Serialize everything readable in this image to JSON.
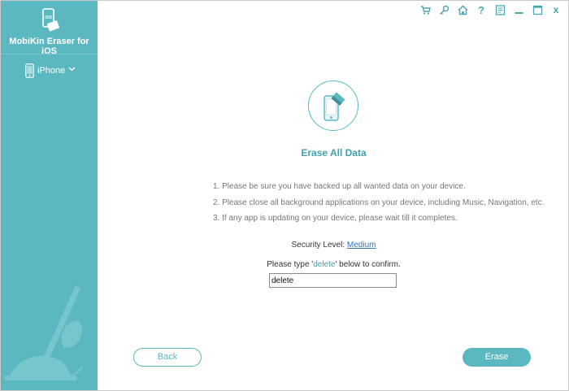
{
  "app": {
    "name": "MobiKin Eraser for iOS",
    "logo_text": "iOS"
  },
  "sidebar": {
    "device_label": "iPhone"
  },
  "titlebar": {
    "icons": [
      "cart-icon",
      "key-icon",
      "home-icon",
      "help-icon",
      "feedback-icon",
      "minimize-icon",
      "maximize-icon",
      "close-icon"
    ],
    "close_label": "x",
    "help_label": "?"
  },
  "main": {
    "heading": "Erase All Data",
    "steps": [
      "1. Please be sure you have backed up all wanted data on your device.",
      "2. Please close all background applications on your device, including Music, Navigation, etc.",
      "3. If any app is updating on your device, please wait till it completes."
    ],
    "security_prefix": "Security Level: ",
    "security_level": "Medium",
    "confirm_prefix": "Please type '",
    "confirm_keyword": "delete",
    "confirm_suffix": "' below to confirm.",
    "confirm_value": "delete"
  },
  "buttons": {
    "back": "Back",
    "erase": "Erase"
  },
  "colors": {
    "accent": "#5bb8c0",
    "heading": "#3fa2ac",
    "link": "#2f74c0"
  }
}
